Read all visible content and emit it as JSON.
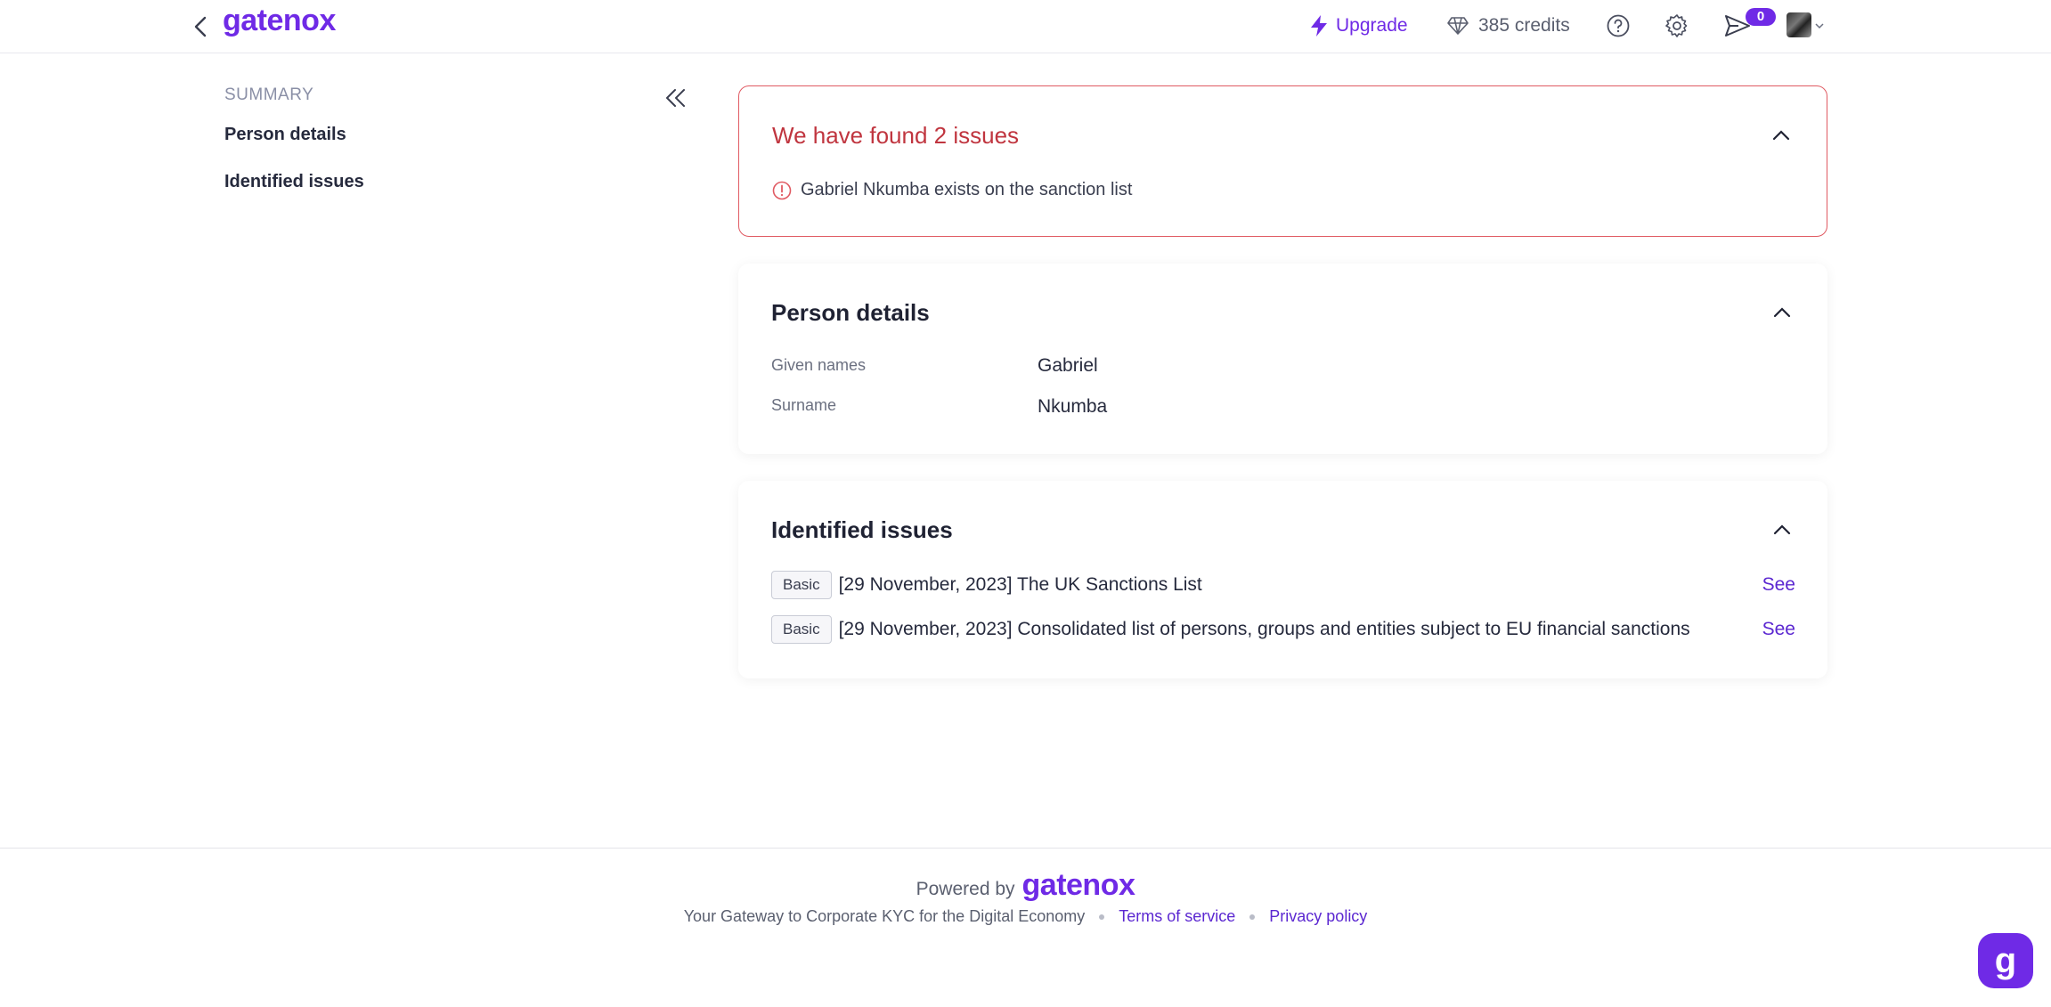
{
  "app": {
    "logo": "gatenox"
  },
  "header": {
    "upgrade_label": "Upgrade",
    "credits_label": "385 credits",
    "notifications_count": "0"
  },
  "sidebar": {
    "title": "SUMMARY",
    "items": [
      {
        "label": "Person details"
      },
      {
        "label": "Identified issues"
      }
    ]
  },
  "alert": {
    "title": "We have found 2 issues",
    "items": [
      {
        "text": "Gabriel Nkumba exists on the sanction list"
      }
    ]
  },
  "person_details": {
    "title": "Person details",
    "fields": [
      {
        "label": "Given names",
        "value": "Gabriel"
      },
      {
        "label": "Surname",
        "value": "Nkumba"
      }
    ]
  },
  "identified_issues": {
    "title": "Identified issues",
    "rows": [
      {
        "badge": "Basic",
        "text": "[29 November, 2023] The UK Sanctions List",
        "action": "See"
      },
      {
        "badge": "Basic",
        "text": "[29 November, 2023] Consolidated list of persons, groups and entities subject to EU financial sanctions",
        "action": "See"
      }
    ]
  },
  "footer": {
    "powered_by": "Powered by",
    "logo": "gatenox",
    "tagline": "Your Gateway to Corporate KYC for the Digital Economy",
    "terms": "Terms of service",
    "privacy": "Privacy policy"
  },
  "chat": {
    "label": "g"
  },
  "colors": {
    "brand": "#6f2ae6",
    "alert": "#c0353f",
    "link": "#5b27d1"
  }
}
